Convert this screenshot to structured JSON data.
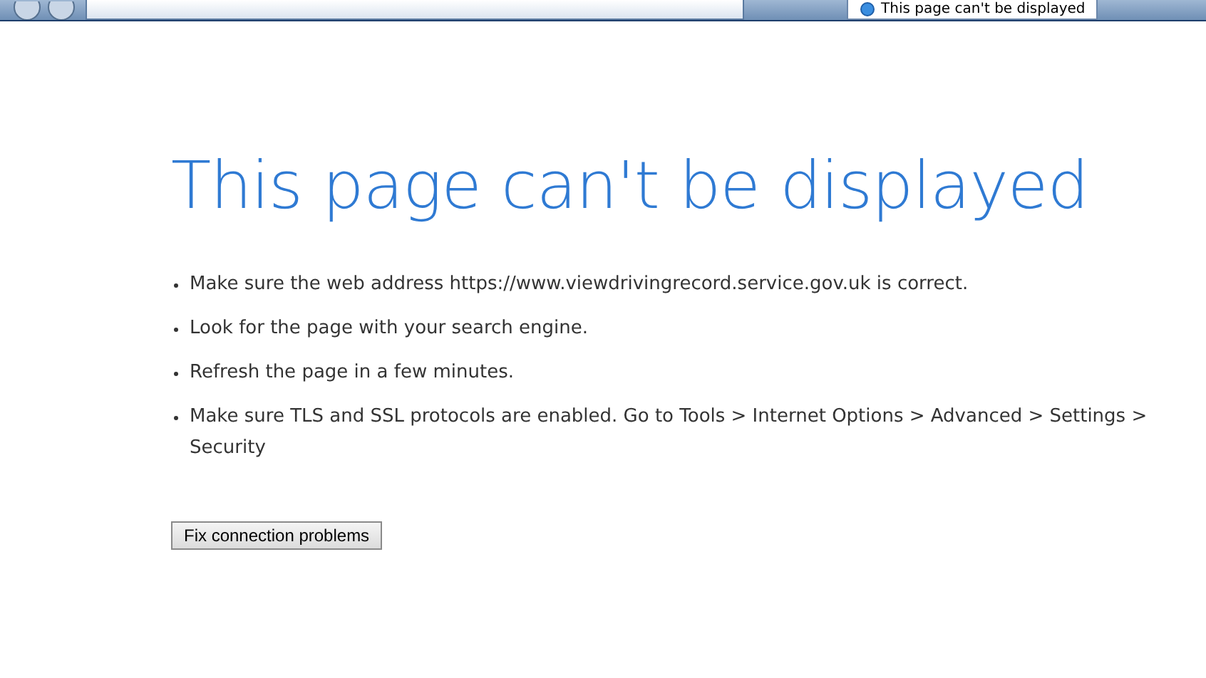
{
  "browser_tab": {
    "title": "This page can't be displayed"
  },
  "heading": "This page can't be displayed",
  "suggestions": [
    "Make sure the web address https://www.viewdrivingrecord.service.gov.uk is correct.",
    "Look for the page with your search engine.",
    "Refresh the page in a few minutes.",
    "Make sure TLS and SSL protocols are enabled. Go to Tools > Internet Options > Advanced > Settings > Security"
  ],
  "button": "Fix connection problems"
}
